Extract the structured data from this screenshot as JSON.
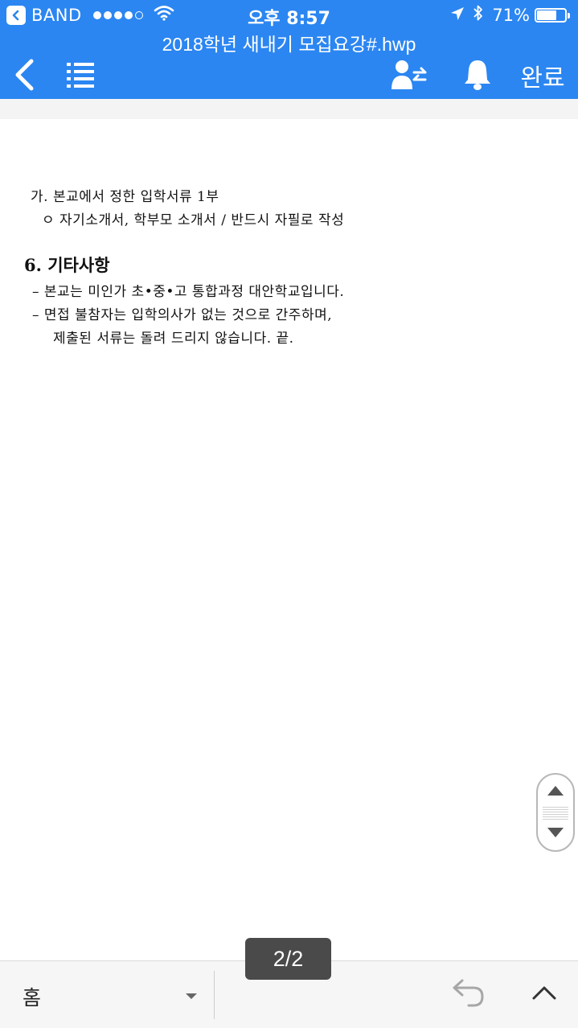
{
  "status_bar": {
    "app_name": "BAND",
    "time": "오후 8:57",
    "battery_text": "71%",
    "battery_level": 0.71,
    "signal_bars_filled": 4,
    "signal_bars_total": 5
  },
  "header": {
    "title": "2018학년 새내기 모집요강#.hwp",
    "done_label": "완료",
    "color": "#2b86f1"
  },
  "icons": {
    "back": "chevron-left-icon",
    "list": "list-icon",
    "share_user": "user-transfer-icon",
    "notification": "bell-icon",
    "scroll_up": "triangle-up-icon",
    "scroll_down": "triangle-down-icon",
    "undo": "undo-icon",
    "collapse": "chevron-up-icon"
  },
  "document": {
    "lines": [
      "가. 본교에서 정한 입학서류 1부",
      "ㅇ 자기소개서, 학부모 소개서 / 반드시 자필로 작성"
    ],
    "section_heading": "6. 기타사항",
    "section_lines": [
      "– 본교는 미인가 초•중•고 통합과정 대안학교입니다.",
      "– 면접 불참자는 입학의사가 없는 것으로 간주하며,",
      "제출된 서류는 돌려 드리지 않습니다.  끝."
    ]
  },
  "pager": {
    "indicator": "2/2"
  },
  "bottom_bar": {
    "home_label": "홈"
  }
}
